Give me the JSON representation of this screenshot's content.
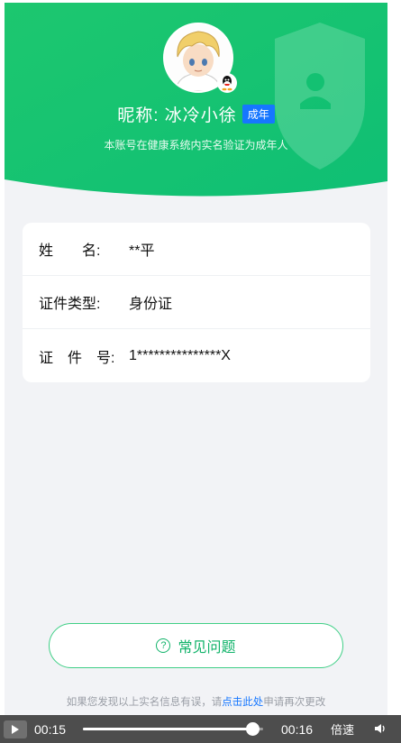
{
  "profile": {
    "nickname": "昵称: 冰冷小徐",
    "age_badge": "成年",
    "verify_note": "本账号在健康系统内实名验证为成年人"
  },
  "identity": {
    "rows": [
      {
        "label": "姓　　名:",
        "value": "**平"
      },
      {
        "label": "证件类型:",
        "value": "身份证"
      },
      {
        "label": "证　件　号:",
        "value": "1***************X"
      }
    ]
  },
  "faq": {
    "label": "常见问题",
    "icon": "question-circle-icon"
  },
  "footer": {
    "prefix": "如果您发现以上实名信息有误，请",
    "link": "点击此处",
    "suffix": "申请再次更改"
  },
  "player": {
    "current_time": "00:15",
    "total_time": "00:16",
    "progress": 0.94,
    "speed_label": "倍速",
    "play_icon": "play-icon",
    "volume_icon": "volume-icon"
  },
  "colors": {
    "hero_green_start": "#1dc76f",
    "hero_green_end": "#0fbf74",
    "accent_blue": "#1677ff",
    "faq_green": "#11b36a"
  }
}
